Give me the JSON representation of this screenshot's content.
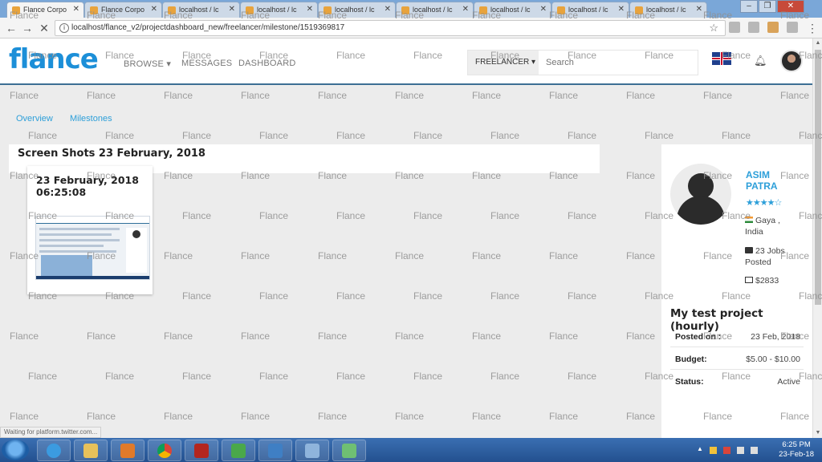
{
  "browser": {
    "tabs": [
      {
        "label": "Flance Corpo"
      },
      {
        "label": "Flance Corpo"
      },
      {
        "label": "localhost / lc"
      },
      {
        "label": "localhost / lc"
      },
      {
        "label": "localhost / lc"
      },
      {
        "label": "localhost / lc"
      },
      {
        "label": "localhost / lc"
      },
      {
        "label": "localhost / lc"
      },
      {
        "label": "localhost / lc"
      }
    ],
    "url": "localhost/flance_v2/projectdashboard_new/freelancer/milestone/1519369817",
    "status_text": "Waiting for platform.twitter.com..."
  },
  "header": {
    "logo": "flance",
    "nav": {
      "browse": "BROWSE ▾",
      "messages": "MESSAGES",
      "dashboard": "DASHBOARD"
    },
    "role_select": "FREELANCER ▾",
    "search_placeholder": "Search"
  },
  "subnav": {
    "overview": "Overview",
    "milestones": "Milestones"
  },
  "screenshots": {
    "title": "Screen Shots 23 February, 2018",
    "item": {
      "timestamp": "23 February, 2018 06:25:08"
    }
  },
  "profile": {
    "name": "ASIM PATRA",
    "rating": "★★★★☆",
    "location": "Gaya , India",
    "jobs_posted": "23 Jobs Posted",
    "spent": "$2833",
    "project_title": "My test project (hourly)",
    "rows": [
      {
        "label": "Posted on :",
        "value": "23 Feb, 2018"
      },
      {
        "label": "Budget:",
        "value": "$5.00 - $10.00"
      },
      {
        "label": "Status:",
        "value": "Active"
      }
    ]
  },
  "watermark": {
    "text": "Flance"
  },
  "taskbar": {
    "time": "6:25 PM",
    "date": "23-Feb-18"
  },
  "colors": {
    "accent": "#2d9fd9",
    "logo": "#1c8fd8",
    "header_border": "#3d6f94",
    "taskbar": "#2a5b9e"
  }
}
